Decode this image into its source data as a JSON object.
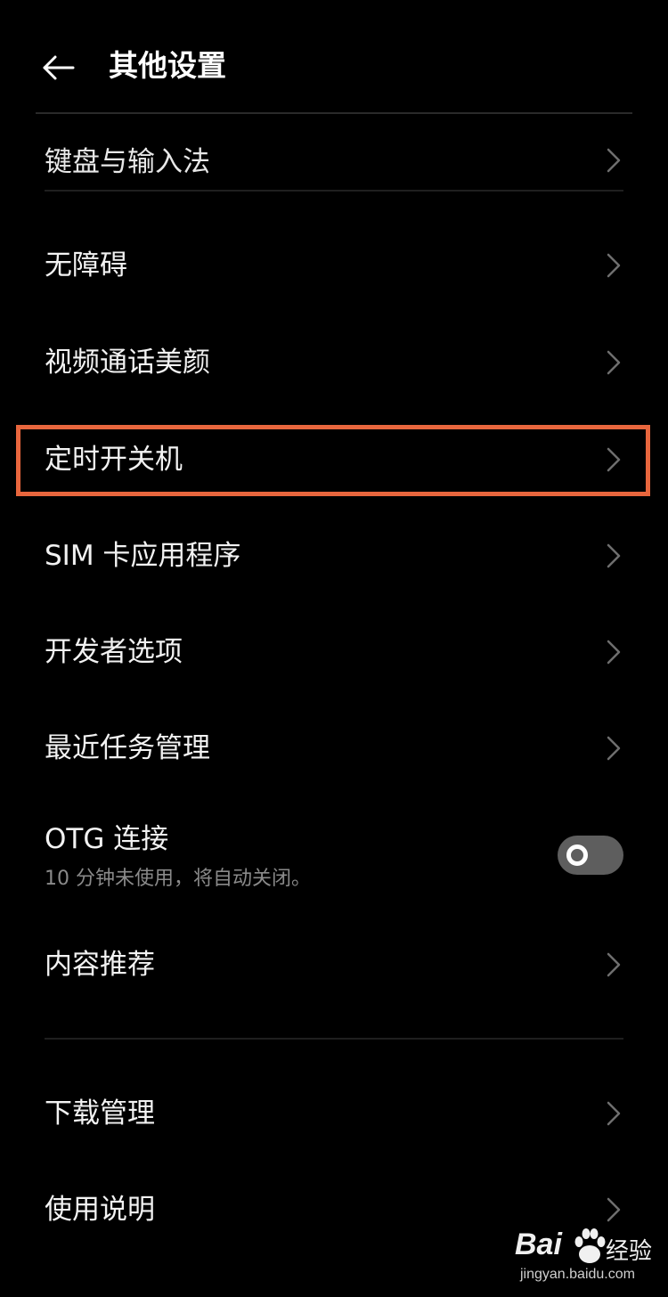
{
  "header": {
    "title": "其他设置",
    "back_icon": "arrow-left-icon"
  },
  "cut_item": {
    "label": "键盘与输入法"
  },
  "items": [
    {
      "label": "无障碍"
    },
    {
      "label": "视频通话美颜"
    },
    {
      "label": "定时开关机",
      "highlighted": true
    },
    {
      "label": "SIM 卡应用程序"
    },
    {
      "label": "开发者选项"
    },
    {
      "label": "最近任务管理"
    }
  ],
  "otg": {
    "label": "OTG 连接",
    "subtitle": "10 分钟未使用，将自动关闭。",
    "enabled": false
  },
  "content_item": {
    "label": "内容推荐"
  },
  "bottom_items": [
    {
      "label": "下载管理"
    },
    {
      "label": "使用说明"
    }
  ],
  "watermark": {
    "brand": "Bai",
    "brand_suffix": "经验",
    "url": "jingyan.baidu.com"
  },
  "colors": {
    "background": "#000000",
    "highlight": "#e8663d",
    "toggle_off": "#5e5e5e"
  }
}
